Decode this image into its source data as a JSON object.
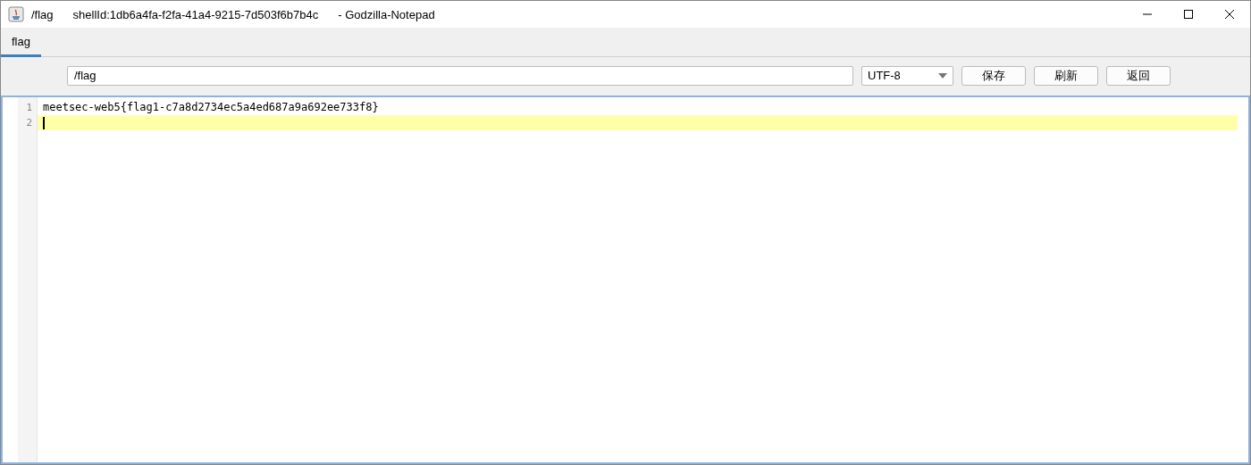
{
  "window": {
    "title_parts": [
      "/flag",
      "shellId:1db6a4fa-f2fa-41a4-9215-7d503f6b7b4c",
      "- Godzilla-Notepad"
    ]
  },
  "tabs": [
    {
      "label": "flag",
      "selected": true
    }
  ],
  "toolbar": {
    "path_field": {
      "value": "/flag"
    },
    "encoding": {
      "value": "UTF-8"
    },
    "buttons": [
      "保存",
      "刷新",
      "返回"
    ]
  },
  "editor": {
    "lines": [
      {
        "number": "1",
        "text": "meetsec-web5{flag1-c7a8d2734ec5a4ed687a9a692ee733f8}",
        "current": false
      },
      {
        "number": "2",
        "current": true
      }
    ]
  }
}
